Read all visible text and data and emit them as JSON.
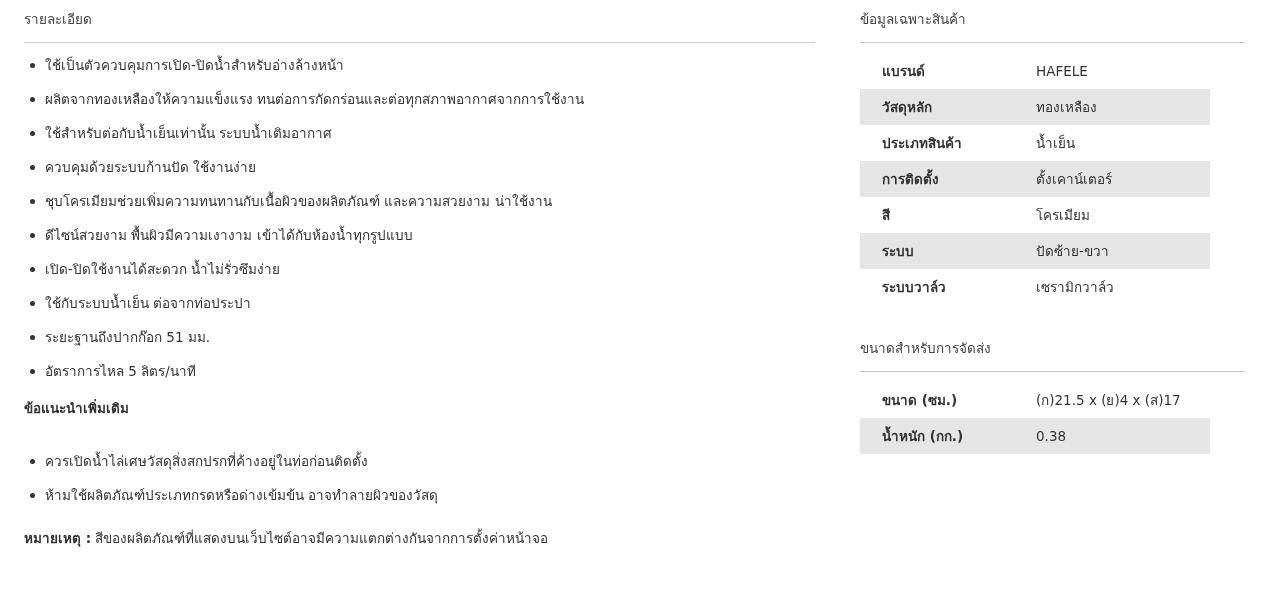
{
  "details": {
    "title": "รายละเอียด",
    "features": [
      "ใช้เป็นตัวควบคุมการเปิด-ปิดน้ำสำหรับอ่างล้างหน้า",
      "ผลิตจากทองเหลืองให้ความแข็งแรง ทนต่อการกัดกร่อนและต่อทุกสภาพอากาศจากการใช้งาน",
      "ใช้สำหรับต่อกับน้ำเย็นเท่านั้น ระบบน้ำเติมอากาศ",
      "ควบคุมด้วยระบบก้านปัด ใช้งานง่าย",
      "ชุบโครเมียมช่วยเพิ่มความทนทานกับเนื้อผิวของผลิตภัณฑ์ และความสวยงาม น่าใช้งาน",
      "ดีไซน์สวยงาม พื้นผิวมีความเงางาม เข้าได้กับห้องน้ำทุกรูปแบบ",
      "เปิด-ปิดใช้งานได้สะดวก น้ำไม่รั่วซึมง่าย",
      "ใช้กับระบบน้ำเย็น ต่อจากท่อประปา",
      "ระยะฐานถึงปากก๊อก 51 มม.",
      "อัตราการไหล 5 ลิตร/นาที"
    ],
    "advice_title": "ข้อแนะนำเพิ่มเติม",
    "advice": [
      "ควรเปิดน้ำไล่เศษวัสดุสิ่งสกปรกที่ค้างอยู่ในท่อก่อนติดตั้ง",
      "ห้ามใช้ผลิตภัณฑ์ประเภทกรดหรือด่างเข้มข้น อาจทำลายผิวของวัสดุ"
    ],
    "note": "**หมายเหตุ :** สีของผลิตภัณฑ์ที่แสดงบนเว็บไซต์อาจมีความแตกต่างกันจากการตั้งค่าหน้าจอ"
  },
  "specs": {
    "title": "ข้อมูลเฉพาะสินค้า",
    "rows": [
      {
        "label": "แบรนด์",
        "value": "HAFELE"
      },
      {
        "label": "วัสดุหลัก",
        "value": "ทองเหลือง"
      },
      {
        "label": "ประเภทสินค้า",
        "value": "น้ำเย็น"
      },
      {
        "label": "การติดตั้ง",
        "value": "ตั้งเคาน์เตอร์"
      },
      {
        "label": "สี",
        "value": "โครเมียม"
      },
      {
        "label": "ระบบ",
        "value": "ปัดซ้าย-ขวา"
      },
      {
        "label": "ระบบวาล์ว",
        "value": "เซรามิกวาล์ว"
      }
    ]
  },
  "shipping": {
    "title": "ขนาดสำหรับการจัดส่ง",
    "rows": [
      {
        "label": "ขนาด (ซม.)",
        "value": "(ก)21.5 x (ย)4 x (ส)17"
      },
      {
        "label": "น้ำหนัก (กก.)",
        "value": "0.38"
      }
    ]
  }
}
